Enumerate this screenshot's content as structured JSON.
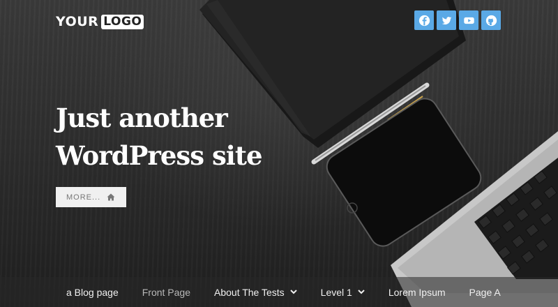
{
  "header": {
    "logo": {
      "word": "YOUR",
      "boxed": "LOGO"
    },
    "social": [
      {
        "name": "facebook",
        "icon": "facebook-icon",
        "color": "#5aa9e6"
      },
      {
        "name": "twitter",
        "icon": "twitter-icon",
        "color": "#5aa9e6"
      },
      {
        "name": "youtube",
        "icon": "youtube-icon",
        "color": "#5aa9e6"
      },
      {
        "name": "github",
        "icon": "github-icon",
        "color": "#5aa9e6"
      }
    ]
  },
  "hero": {
    "title_line1": "Just another",
    "title_line2": "WordPress site",
    "more_label": "MORE...",
    "more_icon": "home-icon"
  },
  "nav": {
    "items": [
      {
        "label": "a Blog page",
        "has_dropdown": false,
        "current": false
      },
      {
        "label": "Front Page",
        "has_dropdown": false,
        "current": true
      },
      {
        "label": "About The Tests",
        "has_dropdown": true,
        "current": false
      },
      {
        "label": "Level 1",
        "has_dropdown": true,
        "current": false
      },
      {
        "label": "Lorem Ipsum",
        "has_dropdown": false,
        "current": false
      },
      {
        "label": "Page A",
        "has_dropdown": false,
        "current": false
      }
    ]
  }
}
